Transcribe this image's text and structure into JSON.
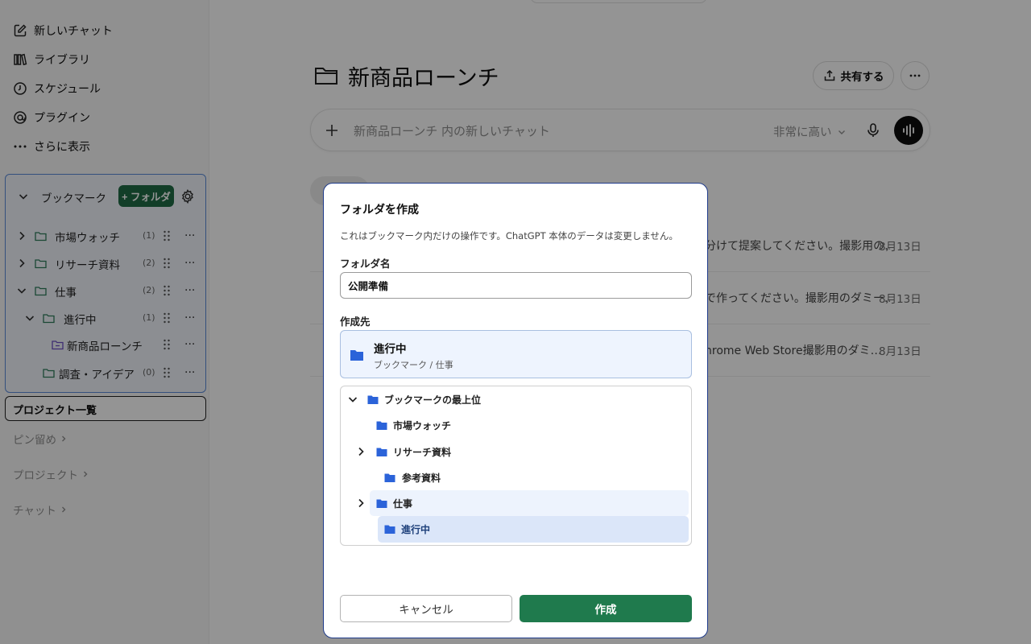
{
  "sidebar": {
    "nav": [
      {
        "label": "新しいチャット",
        "icon": "edit-icon"
      },
      {
        "label": "ライブラリ",
        "icon": "library-icon"
      },
      {
        "label": "スケジュール",
        "icon": "clock-icon"
      },
      {
        "label": "プラグイン",
        "icon": "plugin-icon"
      },
      {
        "label": "さらに表示",
        "icon": "ellipsis-icon"
      }
    ],
    "bookmarks": {
      "title": "ブックマーク",
      "add_label": "+ フォルダ",
      "items": [
        {
          "label": "市場ウォッチ",
          "count": "(1)"
        },
        {
          "label": "リサーチ資料",
          "count": "(2)"
        },
        {
          "label": "仕事",
          "count": "(2)"
        },
        {
          "label": "進行中",
          "count": "(1)"
        },
        {
          "label": "新商品ローンチ",
          "count": ""
        },
        {
          "label": "調査・アイデア",
          "count": "(0)"
        }
      ],
      "more": "..."
    },
    "project_list": "プロジェクト一覧",
    "sections": [
      "ピン留め",
      "プロジェクト",
      "チャット"
    ]
  },
  "main": {
    "title": "新商品ローンチ",
    "share_label": "共有する",
    "composer": {
      "placeholder": "新商品ローンチ 内の新しいチャット",
      "model": "非常に高い"
    },
    "chats": [
      {
        "snippet": "分けて提案してください。撮影用の…",
        "date": "8月13日"
      },
      {
        "snippet": "で作ってください。撮影用のダミー…",
        "date": "8月13日"
      },
      {
        "snippet": "hrome Web Store撮影用のダミ…",
        "date": "8月13日"
      }
    ]
  },
  "dialog": {
    "title": "フォルダを作成",
    "description": "これはブックマーク内だけの操作です。ChatGPT 本体のデータは変更しません。",
    "name_label": "フォルダ名",
    "name_value": "公開準備",
    "dest_label": "作成先",
    "dest_selected": {
      "name": "進行中",
      "path": "ブックマーク / 仕事"
    },
    "tree": [
      {
        "label": "ブックマークの最上位"
      },
      {
        "label": "市場ウォッチ"
      },
      {
        "label": "リサーチ資料"
      },
      {
        "label": "参考資料"
      },
      {
        "label": "仕事"
      },
      {
        "label": "進行中"
      }
    ],
    "cancel_label": "キャンセル",
    "create_label": "作成"
  },
  "colors": {
    "accent_green": "#1f7a4d",
    "folder_blue": "#2b63d9",
    "folder_green": "#2e7d5b",
    "selected_bg": "#e0eafb"
  }
}
